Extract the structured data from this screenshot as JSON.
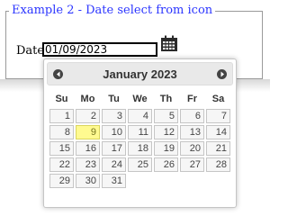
{
  "example": {
    "legend": "Example 2 - Date select from icon",
    "date_label": "Date:",
    "date_value": "01/09/2023"
  },
  "datepicker": {
    "month_title": "January 2023",
    "weekdays": [
      "Su",
      "Mo",
      "Tu",
      "We",
      "Th",
      "Fr",
      "Sa"
    ],
    "weeks": [
      [
        "",
        "",
        "",
        "",
        "",
        "",
        ""
      ],
      [
        "1",
        "2",
        "3",
        "4",
        "5",
        "6",
        "7"
      ],
      [
        "8",
        "9",
        "10",
        "11",
        "12",
        "13",
        "14"
      ],
      [
        "15",
        "16",
        "17",
        "18",
        "19",
        "20",
        "21"
      ],
      [
        "22",
        "23",
        "24",
        "25",
        "26",
        "27",
        "28"
      ],
      [
        "29",
        "30",
        "31",
        "",
        "",
        "",
        ""
      ]
    ],
    "highlighted_day": "9",
    "icons": {
      "prev": "chevron-left-icon",
      "next": "chevron-right-icon",
      "trigger": "calendar-icon"
    },
    "colors": {
      "legend": "#2b35ff",
      "highlight": "#fffa90"
    }
  }
}
